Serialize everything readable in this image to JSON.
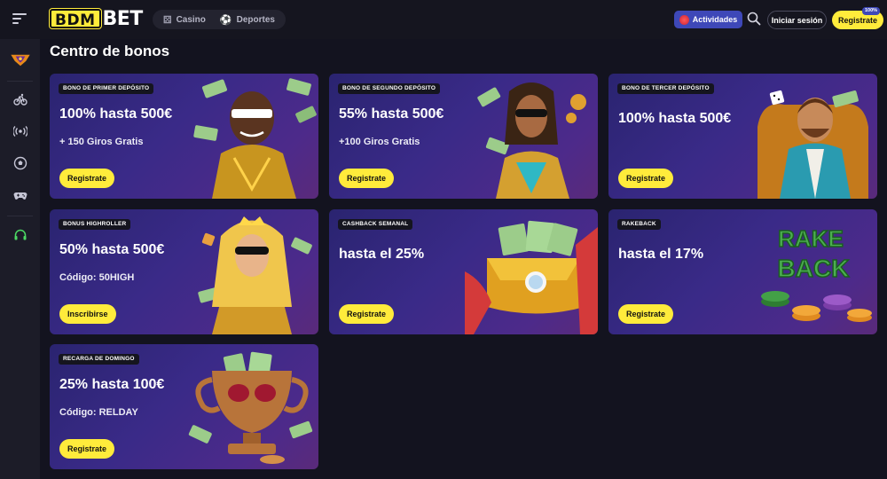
{
  "header": {
    "logo_left": "BDM",
    "logo_right": "BET",
    "nav": [
      {
        "label": "Casino",
        "icon": "dice-icon"
      },
      {
        "label": "Deportes",
        "icon": "soccer-icon"
      }
    ],
    "actividades_label": "Actividades",
    "login_label": "Iniciar sesión",
    "register_label": "Registrate",
    "register_badge": "100%"
  },
  "sidebar": {
    "items": [
      {
        "icon": "trophy-badge-icon"
      },
      {
        "icon": "bike-icon"
      },
      {
        "icon": "live-broadcast-icon"
      },
      {
        "icon": "soccer-ball-icon"
      },
      {
        "icon": "gamepad-icon"
      },
      {
        "icon": "headset-icon"
      }
    ]
  },
  "page": {
    "title": "Centro de bonos"
  },
  "bonuses": [
    {
      "tag": "BONO DE PRIMER DEPÓSITO",
      "title": "100% hasta 500€",
      "subtitle": "+ 150 Giros Gratis",
      "button": "Registrate",
      "art": "money-man"
    },
    {
      "tag": "BONO DE SEGUNDO DEPÓSITO",
      "title": "55% hasta 500€",
      "subtitle": "+100 Giros Gratis",
      "button": "Registrate",
      "art": "gold-woman"
    },
    {
      "tag": "BONO DE TERCER DEPÓSITO",
      "title": "100% hasta 500€",
      "subtitle": "",
      "button": "Registrate",
      "art": "throne-man"
    },
    {
      "tag": "BONUS HIGHROLLER",
      "title": "50% hasta 500€",
      "subtitle": "Código: 50HIGH",
      "button": "Inscribirse",
      "art": "blonde-woman"
    },
    {
      "tag": "CASHBACK SEMANAL",
      "title": "hasta el 25%",
      "subtitle": "",
      "button": "Registrate",
      "art": "money-bag"
    },
    {
      "tag": "RAKEBACK",
      "title": "hasta el 17%",
      "subtitle": "",
      "button": "Registrate",
      "art": "rakeback-chips"
    },
    {
      "tag": "RECARGA DE DOMINGO",
      "title": "25% hasta 100€",
      "subtitle": "Código: RELDAY",
      "button": "Registrate",
      "art": "trophy-cup"
    }
  ],
  "colors": {
    "accent_yellow": "#ffeb3b",
    "actividades_blue": "#3e48b8",
    "bg": "#13131f"
  }
}
